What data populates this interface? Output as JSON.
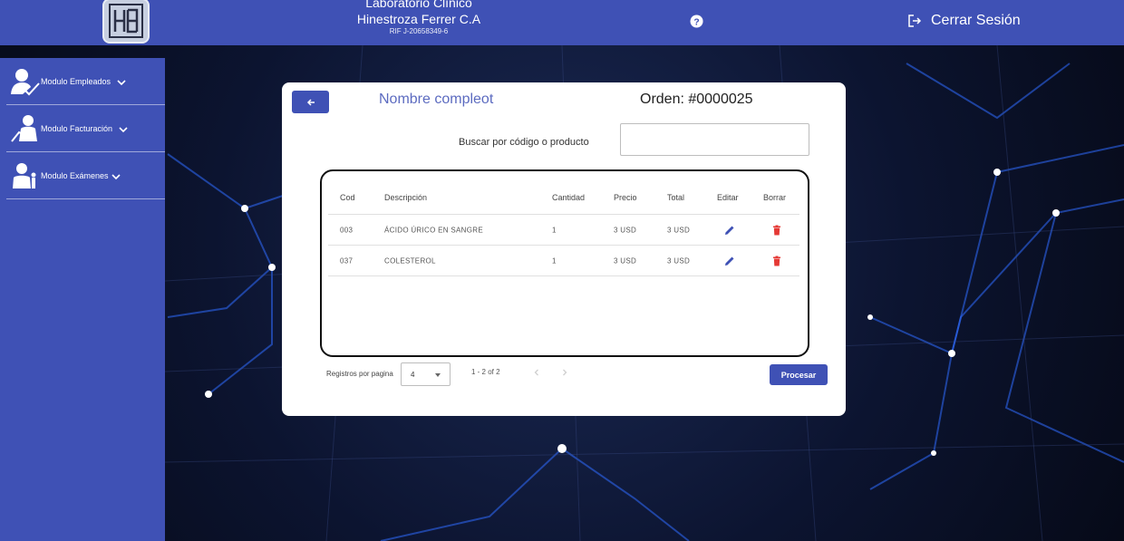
{
  "header": {
    "title_line1": "Laboratorio Clínico",
    "title_line2": "Hinestroza Ferrer C.A",
    "rif": "RIF J-20658349-6",
    "logout_label": "Cerrar Sesión",
    "help_icon": "help-circle-icon",
    "logout_icon": "logout-icon"
  },
  "sidebar": {
    "items": [
      {
        "label": "Modulo Empleados",
        "icon": "employee-icon"
      },
      {
        "label": "Modulo Facturación",
        "icon": "billing-icon"
      },
      {
        "label": "Modulo Exámenes",
        "icon": "exam-icon"
      }
    ]
  },
  "card": {
    "back_icon": "arrow-left-icon",
    "name_label": "Nombre compleot",
    "order_label": "Orden: #0000025",
    "search_label": "Buscar por código o producto",
    "search_value": ""
  },
  "table": {
    "columns": [
      "Cod",
      "Descripción",
      "Cantidad",
      "Precio",
      "Total",
      "Editar",
      "Borrar"
    ],
    "rows": [
      {
        "cod": "003",
        "descripcion": "ÁCIDO ÚRICO EN SANGRE",
        "cantidad": "1",
        "precio": "3 USD",
        "total": "3 USD"
      },
      {
        "cod": "037",
        "descripcion": "COLESTEROL",
        "cantidad": "1",
        "precio": "3 USD",
        "total": "3 USD"
      }
    ]
  },
  "pagination": {
    "label": "Registros por pagina",
    "page_size": "4",
    "range": "1 - 2 of 2"
  },
  "actions": {
    "process_label": "Procesar"
  },
  "colors": {
    "primary": "#3f51b5",
    "delete": "#e53935",
    "edit": "#3f51b5"
  }
}
